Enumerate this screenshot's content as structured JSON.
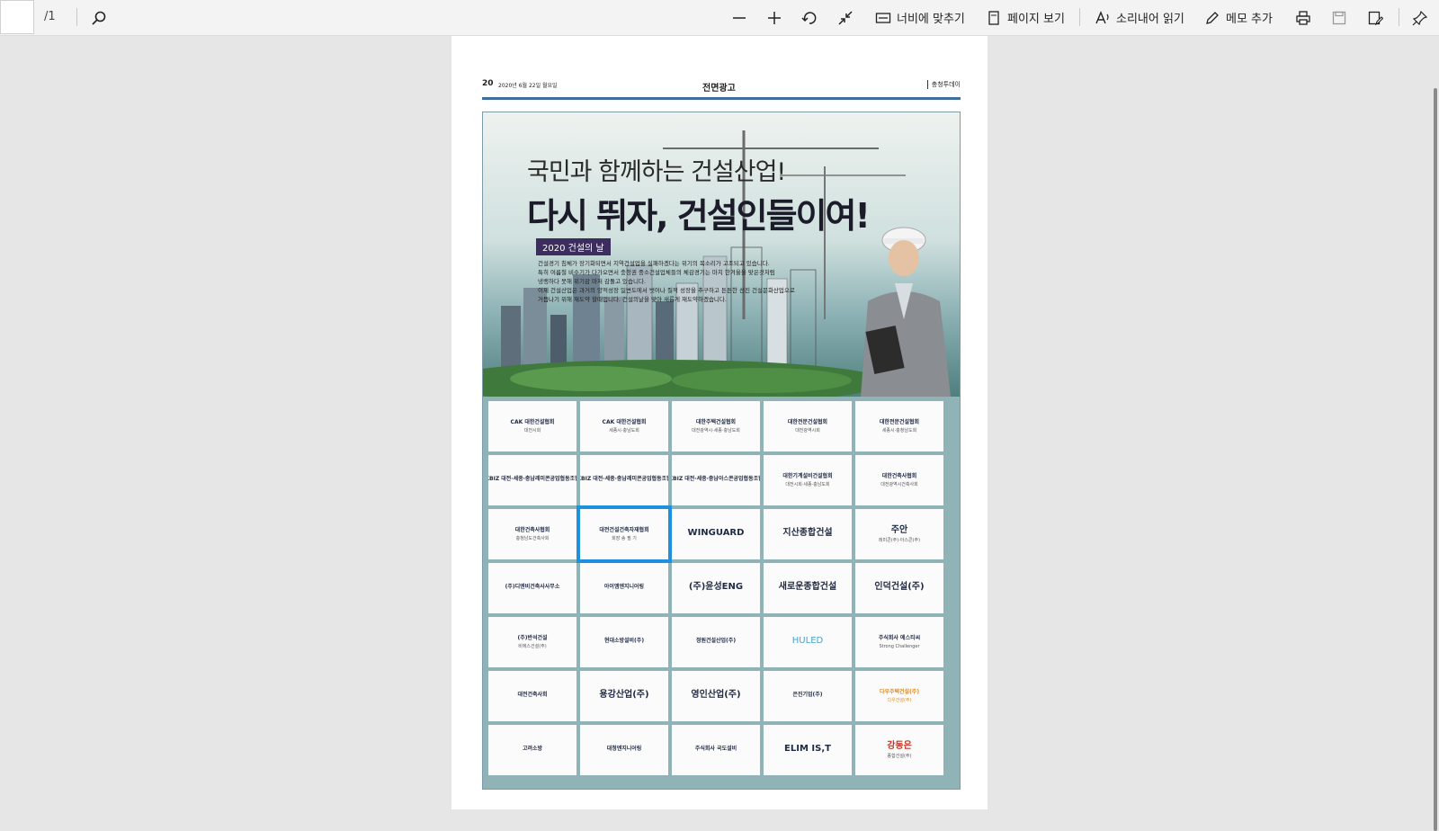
{
  "toolbar": {
    "page_total": "/1",
    "fit_width": "너비에 맞추기",
    "page_view": "페이지 보기",
    "read_aloud": "소리내어 읽기",
    "add_note": "메모 추가"
  },
  "newspaper": {
    "page_number": "20",
    "date": "2020년 6월 22일 월요일",
    "section": "전면광고",
    "paper_name": "충청투데이"
  },
  "ad": {
    "subtitle": "국민과 함께하는 건설산업!",
    "headline": "다시 뛰자, 건설인들이여!",
    "badge": "2020 건설의 날",
    "body_lines": [
      "건설경기 침체가 장기화되면서 지역건설업을 실패하겠다는 위기의 목소리가 고조되고 있습니다.",
      "특히 여름철 비수기가 다가오면서 충청권 중소건설업체들의 체감경기는 마치 한겨울을 맞은것처럼",
      "냉랭하다 못해 위기감 마저 감돌고 있습니다.",
      "이제 건설산업은 과거의 양적성장 일변도에서 벗어나 질적 성장을 추구하고 튼튼한 선진 건설문화산업으로",
      "거듭나기 위해 재도약 할때입니다. 건설의날을 맞아 새롭게 재도약하겠습니다."
    ]
  },
  "logos": [
    {
      "name": "CAK 대한건설협회",
      "sub": "대전시회",
      "mark": ""
    },
    {
      "name": "CAK 대한건설협회",
      "sub": "세종시·충남도회",
      "mark": ""
    },
    {
      "name": "대한주택건설협회",
      "sub": "대전광역시·세종·충남도회",
      "mark": ""
    },
    {
      "name": "대한전문건설협회",
      "sub": "대전광역시회",
      "mark": ""
    },
    {
      "name": "대한전문건설협회",
      "sub": "세종시·충청남도회",
      "mark": ""
    },
    {
      "name": "KBIZ 대전·세종·충남레미콘공업협동조합",
      "sub": "",
      "mark": ""
    },
    {
      "name": "KBIZ 대전·세종·충남레미콘공업협동조합",
      "sub": "",
      "mark": ""
    },
    {
      "name": "KBIZ 대전·세종·충남아스콘공업협동조합",
      "sub": "",
      "mark": ""
    },
    {
      "name": "대한기계설비건설협회",
      "sub": "대전시회·세종·충남도회",
      "mark": ""
    },
    {
      "name": "대한건축사협회",
      "sub": "대전광역시건축사회",
      "mark": ""
    },
    {
      "name": "대한건축사협회",
      "sub": "충청남도건축사회",
      "mark": ""
    },
    {
      "name": "대전건설건축자재협회",
      "sub": "회장 송 필 기",
      "mark": ""
    },
    {
      "name": "WINGUARD",
      "sub": "",
      "mark": ""
    },
    {
      "name": "지산종합건설",
      "sub": "",
      "mark": ""
    },
    {
      "name": "주안",
      "sub": "레미콘(주)·아스콘(주)",
      "mark": ""
    },
    {
      "name": "(주)디엔비건축사사무소",
      "sub": "",
      "mark": ""
    },
    {
      "name": "아이엠엔지니어링",
      "sub": "",
      "mark": ""
    },
    {
      "name": "(주)윤성ENG",
      "sub": "",
      "mark": ""
    },
    {
      "name": "새로운종합건설",
      "sub": "",
      "mark": ""
    },
    {
      "name": "인덕건설(주)",
      "sub": "",
      "mark": ""
    },
    {
      "name": "(주)반석건설",
      "sub": "비에스건설(주)",
      "mark": ""
    },
    {
      "name": "현대소방설비(주)",
      "sub": "",
      "mark": ""
    },
    {
      "name": "정원건설산업(주)",
      "sub": "",
      "mark": ""
    },
    {
      "name": "HULED",
      "sub": "",
      "mark": ""
    },
    {
      "name": "주식회사 에스티씨",
      "sub": "Strong Challenger",
      "mark": ""
    },
    {
      "name": "대전건축사회",
      "sub": "",
      "mark": ""
    },
    {
      "name": "용강산업(주)",
      "sub": "",
      "mark": ""
    },
    {
      "name": "영인산업(주)",
      "sub": "",
      "mark": ""
    },
    {
      "name": "은진기업(주)",
      "sub": "",
      "mark": ""
    },
    {
      "name": "다우주택건설(주)",
      "sub": "다우건설(주)",
      "mark": ""
    },
    {
      "name": "고려소방",
      "sub": "",
      "mark": ""
    },
    {
      "name": "대청엔지니어링",
      "sub": "",
      "mark": ""
    },
    {
      "name": "주식회사 국도설비",
      "sub": "",
      "mark": ""
    },
    {
      "name": "ELIM IS,T",
      "sub": "",
      "mark": ""
    },
    {
      "name": "강동은",
      "sub": "종합건설(주)",
      "mark": ""
    }
  ],
  "selected_index": 11,
  "colors": {
    "selection": "#1e90e0",
    "rule": "#3d6f9a"
  }
}
